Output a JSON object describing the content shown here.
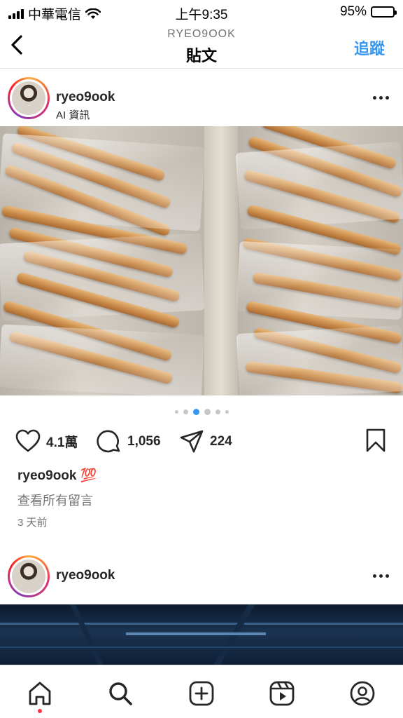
{
  "status_bar": {
    "carrier": "中華電信",
    "time": "上午9:35",
    "battery": "95%",
    "battery_level": 0.95,
    "icons": [
      "signal-icon",
      "wifi-icon",
      "battery-icon"
    ]
  },
  "header": {
    "subtitle": "RYEO9OOK",
    "title": "貼文",
    "follow_label": "追蹤",
    "back_icon": "chevron-left-icon"
  },
  "post": {
    "username": "ryeo9ook",
    "subline": "AI 資訊",
    "carousel": {
      "count": 6,
      "active": 2
    },
    "likes": "4.1萬",
    "comments": "1,056",
    "shares": "224",
    "caption_user": "ryeo9ook",
    "caption_text": "💯",
    "view_comments": "查看所有留言",
    "time_ago": "3 天前"
  },
  "post2": {
    "username": "ryeo9ook"
  },
  "tabbar": {
    "items": [
      "home-icon",
      "search-icon",
      "create-icon",
      "reels-icon",
      "profile-icon"
    ]
  },
  "colors": {
    "accent": "#3797f0",
    "text": "#262626",
    "secondary": "#737373",
    "notification": "#ff3040"
  }
}
